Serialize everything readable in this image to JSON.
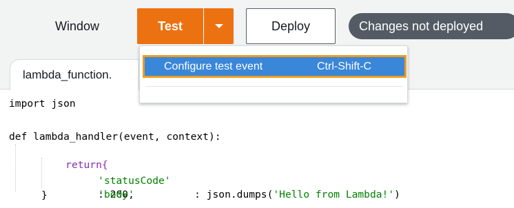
{
  "toolbar": {
    "window_label": "Window",
    "test_label": "Test",
    "test_dropdown_icon": "caret-down-icon",
    "deploy_label": "Deploy",
    "status_badge": "Changes not deployed"
  },
  "tabs": [
    {
      "label": "lambda_function."
    }
  ],
  "dropdown_menu": {
    "items": [
      {
        "label": "Configure test event",
        "shortcut": "Ctrl-Shift-C",
        "highlighted": true
      }
    ]
  },
  "editor": {
    "lines": [
      "import json",
      "",
      "def lambda_handler(event, context):",
      "return{",
      "'statusCode'",
      ": 200,",
      "'body'",
      ": json.dumps(",
      "'Hello from Lambda!'",
      ")",
      "}"
    ]
  },
  "colors": {
    "accent_orange": "#ec7211",
    "menu_highlight_blue": "#3a86d8",
    "focus_outline": "#ec9d20",
    "badge_gray": "#545b64",
    "code_string_green": "#008000"
  }
}
